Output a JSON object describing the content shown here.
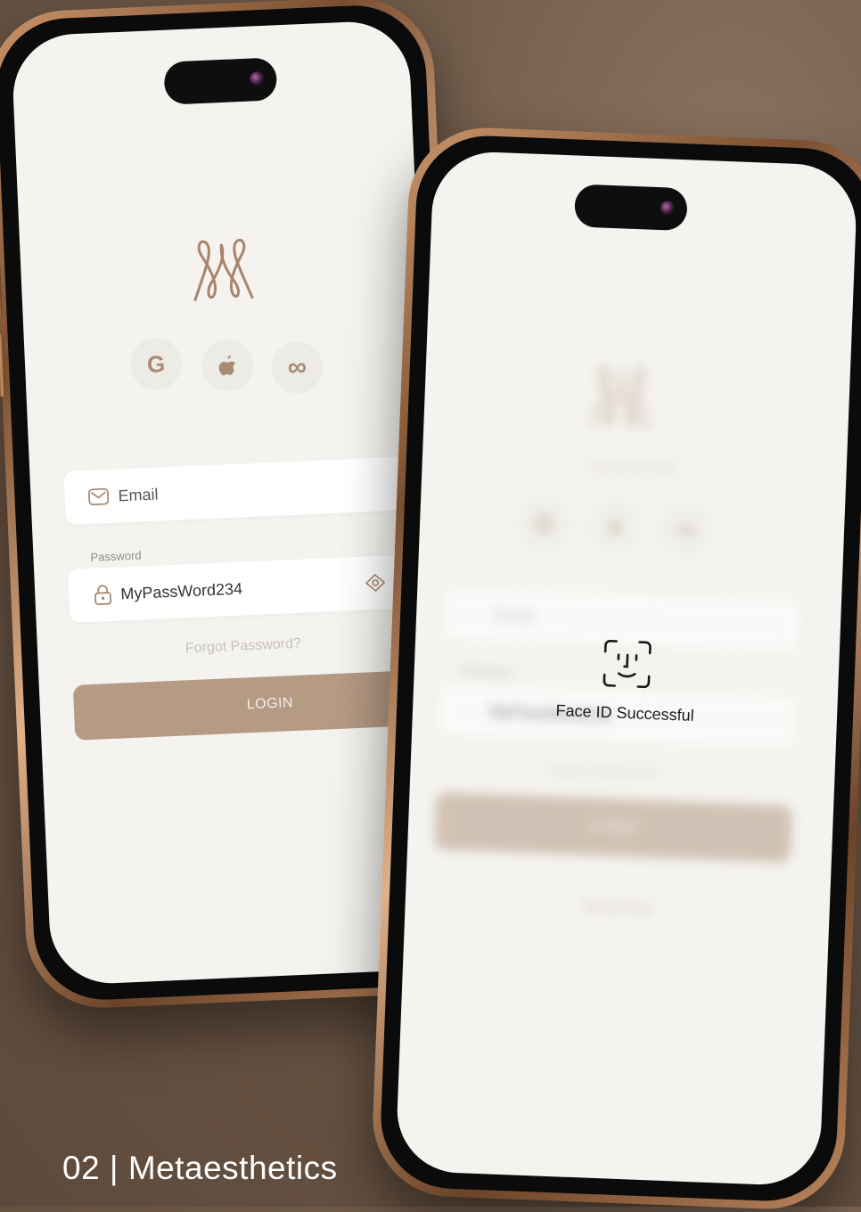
{
  "left_phone": {
    "social": {
      "google": "G",
      "meta": "∞"
    },
    "email_field": {
      "placeholder": "Email"
    },
    "password_label": "Password",
    "password_field": {
      "value": "MyPassWord234"
    },
    "forgot_password": "Forgot Password?",
    "login_button": "LOGIN"
  },
  "right_phone": {
    "blurred": {
      "register_title": "REGISTER",
      "email": "Email",
      "password_label": "Password",
      "password_value": "MyPassWord234",
      "forgot": "Forgot Password?",
      "login": "LOGIN",
      "register": "REGISTER"
    },
    "faceid_status": "Face ID Successful"
  },
  "caption": "02 | Metaesthetics",
  "colors": {
    "accent": "#b59a84",
    "background": "#5e4a3b",
    "screen": "#f4f3ef"
  },
  "icons": [
    "logo-icon",
    "google-icon",
    "apple-icon",
    "meta-icon",
    "mail-icon",
    "lock-icon",
    "eye-icon",
    "faceid-icon"
  ]
}
